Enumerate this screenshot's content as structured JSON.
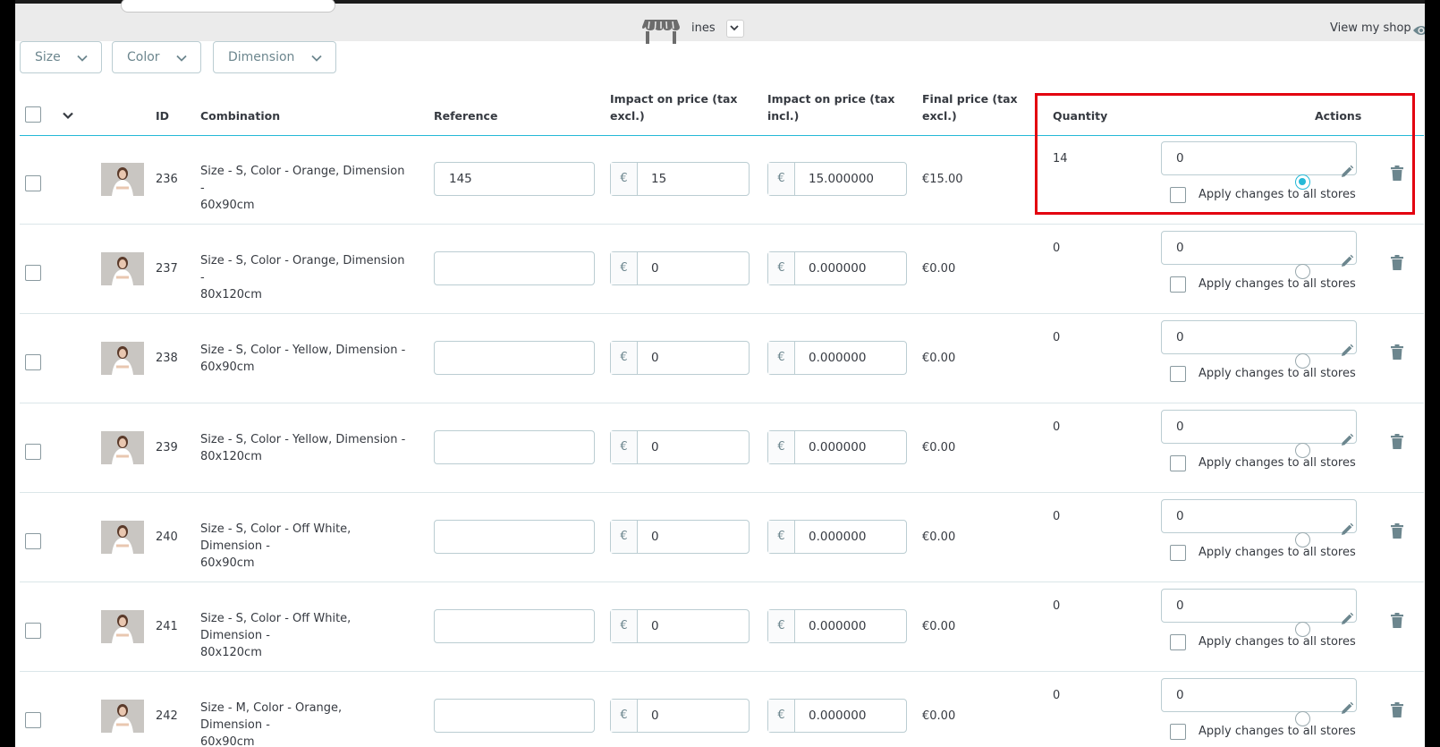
{
  "header": {
    "shop_name": "ines",
    "view_shop_label": "View my shop"
  },
  "filters": [
    {
      "label": "Size"
    },
    {
      "label": "Color"
    },
    {
      "label": "Dimension"
    }
  ],
  "columns": {
    "id": "ID",
    "combination": "Combination",
    "reference": "Reference",
    "impact_excl": [
      "Impact on price (tax",
      "excl.)"
    ],
    "impact_incl": [
      "Impact on price (tax",
      "incl.)"
    ],
    "final_price": [
      "Final price (tax",
      "excl.)"
    ],
    "quantity": "Quantity",
    "actions": "Actions"
  },
  "currency_symbol": "€",
  "apply_label": "Apply changes to all stores",
  "rows": [
    {
      "id": "236",
      "combo": [
        "Size - S, Color - Orange, Dimension -",
        "60x90cm"
      ],
      "reference": "145",
      "impact_excl": "15",
      "impact_incl": "15.000000",
      "final_price": "€15.00",
      "quantity": "14",
      "quantity_input": "0",
      "default": true
    },
    {
      "id": "237",
      "combo": [
        "Size - S, Color - Orange, Dimension -",
        "80x120cm"
      ],
      "reference": "",
      "impact_excl": "0",
      "impact_incl": "0.000000",
      "final_price": "€0.00",
      "quantity": "0",
      "quantity_input": "0",
      "default": false
    },
    {
      "id": "238",
      "combo": [
        "Size - S, Color - Yellow, Dimension -",
        "60x90cm"
      ],
      "reference": "",
      "impact_excl": "0",
      "impact_incl": "0.000000",
      "final_price": "€0.00",
      "quantity": "0",
      "quantity_input": "0",
      "default": false
    },
    {
      "id": "239",
      "combo": [
        "Size - S, Color - Yellow, Dimension -",
        "80x120cm"
      ],
      "reference": "",
      "impact_excl": "0",
      "impact_incl": "0.000000",
      "final_price": "€0.00",
      "quantity": "0",
      "quantity_input": "0",
      "default": false
    },
    {
      "id": "240",
      "combo": [
        "Size - S, Color - Off White, Dimension -",
        "60x90cm"
      ],
      "reference": "",
      "impact_excl": "0",
      "impact_incl": "0.000000",
      "final_price": "€0.00",
      "quantity": "0",
      "quantity_input": "0",
      "default": false
    },
    {
      "id": "241",
      "combo": [
        "Size - S, Color - Off White, Dimension -",
        "80x120cm"
      ],
      "reference": "",
      "impact_excl": "0",
      "impact_incl": "0.000000",
      "final_price": "€0.00",
      "quantity": "0",
      "quantity_input": "0",
      "default": false
    },
    {
      "id": "242",
      "combo": [
        "Size - M, Color - Orange, Dimension -",
        "60x90cm"
      ],
      "reference": "",
      "impact_excl": "0",
      "impact_incl": "0.000000",
      "final_price": "€0.00",
      "quantity": "0",
      "quantity_input": "0",
      "default": false
    }
  ],
  "colors": {
    "accent": "#25b9d7",
    "highlight": "#e3000f"
  }
}
